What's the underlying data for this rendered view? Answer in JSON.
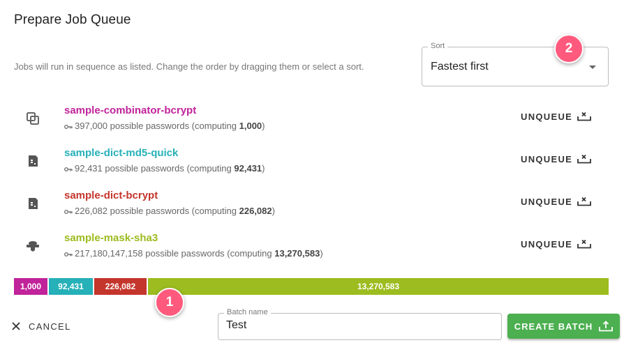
{
  "dialog": {
    "title": "Prepare Job Queue",
    "subtitle": "Jobs will run in sequence as listed. Change the order by dragging them or select a sort."
  },
  "sort": {
    "label": "Sort",
    "value": "Fastest first"
  },
  "badges": [
    "1",
    "2"
  ],
  "jobs": [
    {
      "name": "sample-combinator-bcrypt",
      "color": "#c0239a",
      "icon": "combinator-icon",
      "possible": "397,000",
      "desc_mid": "possible passwords (computing",
      "computing": "1,000",
      "desc_end": ")",
      "action": "UNQUEUE"
    },
    {
      "name": "sample-dict-md5-quick",
      "color": "#26b0b8",
      "icon": "dictionary-icon",
      "possible": "92,431",
      "desc_mid": "possible passwords (computing",
      "computing": "92,431",
      "desc_end": ")",
      "action": "UNQUEUE"
    },
    {
      "name": "sample-dict-bcrypt",
      "color": "#c4352c",
      "icon": "dictionary-icon",
      "possible": "226,082",
      "desc_mid": "possible passwords (computing",
      "computing": "226,082",
      "desc_end": ")",
      "action": "UNQUEUE"
    },
    {
      "name": "sample-mask-sha3",
      "color": "#9cbc1f",
      "icon": "mask-icon",
      "possible": "217,180,147,158",
      "desc_mid": "possible passwords (computing",
      "computing": "13,270,583",
      "desc_end": ")",
      "action": "UNQUEUE"
    }
  ],
  "progress": [
    {
      "label": "1,000",
      "color": "#c0239a"
    },
    {
      "label": "92,431",
      "color": "#26b0b8"
    },
    {
      "label": "226,082",
      "color": "#c4352c"
    },
    {
      "label": "13,270,583",
      "color": "#9cbc1f"
    }
  ],
  "footer": {
    "cancel_label": "CANCEL",
    "batch_label": "Batch name",
    "batch_value": "Test",
    "create_label": "CREATE BATCH"
  }
}
